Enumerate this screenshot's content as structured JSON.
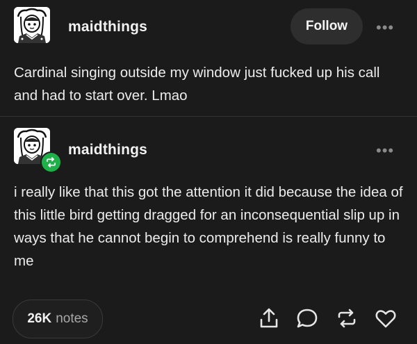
{
  "original_post": {
    "username": "maidthings",
    "follow_label": "Follow",
    "more_label": "•••",
    "avatar_icon": "anime-character-avatar-icon",
    "text": "Cardinal singing outside my window just fucked up his call and had to start over. Lmao"
  },
  "reblog": {
    "username": "maidthings",
    "more_label": "•••",
    "avatar_icon": "anime-character-avatar-icon",
    "badge_icon": "reblog-icon",
    "badge_color": "#1fb04a",
    "text": "i really like that this got the attention it did because the idea of this little bird getting dragged for an inconsequential slip up in ways that he cannot begin to comprehend is really funny to me"
  },
  "footer": {
    "notes_count": "26K",
    "notes_label": "notes",
    "actions": [
      "share-icon",
      "reply-icon",
      "reblog-icon",
      "like-icon"
    ]
  },
  "colors": {
    "background": "#1b1b1b",
    "text": "#ececec",
    "accent_green": "#1fb04a"
  }
}
